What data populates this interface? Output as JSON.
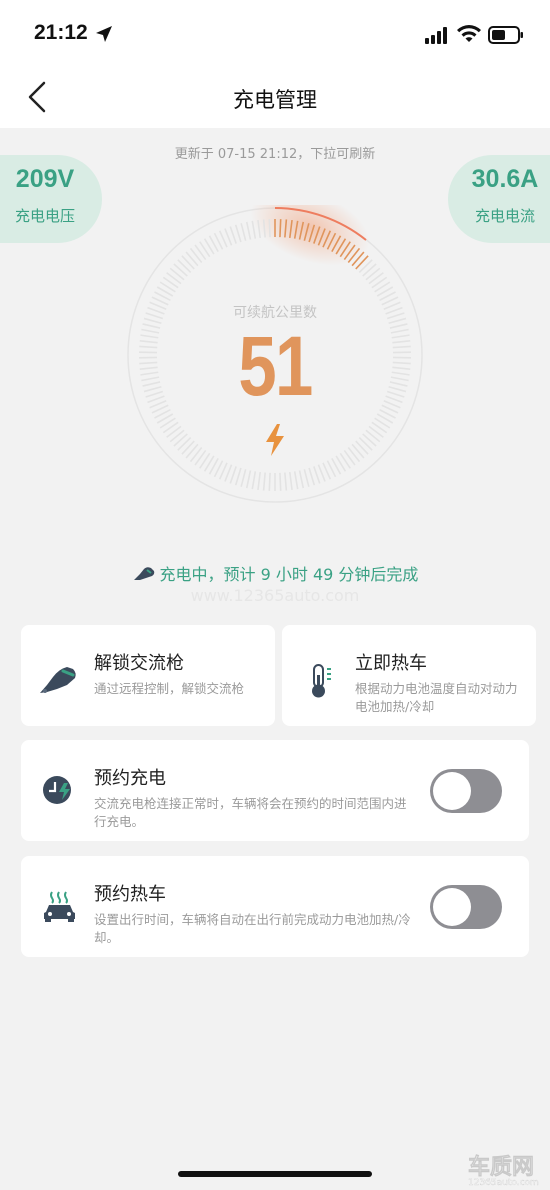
{
  "status_bar": {
    "time": "21:12",
    "icons": [
      "location-arrow-icon",
      "cellular-signal-icon",
      "wifi-icon",
      "battery-icon"
    ]
  },
  "header": {
    "title": "充电管理",
    "back_icon": "chevron-left-icon"
  },
  "update_text": "更新于 07-15 21:12，下拉可刷新",
  "voltage": {
    "value": "209V",
    "label": "充电电压"
  },
  "current": {
    "value": "30.6A",
    "label": "充电电流"
  },
  "gauge": {
    "label": "可续航公里数",
    "value": "51",
    "icon": "lightning-bolt-icon",
    "colors": {
      "accent": "#e0955c",
      "track": "#e3e3e3"
    }
  },
  "charge_status": "充电中，预计 9 小时 49 分钟后完成",
  "watermark": "www.12365auto.com",
  "cards": {
    "unlock": {
      "title": "解锁交流枪",
      "desc": "通过远程控制，解锁交流枪",
      "icon": "charging-gun-icon"
    },
    "heat_now": {
      "title": "立即热车",
      "desc": "根据动力电池温度自动对动力电池加热/冷却",
      "icon": "thermometer-icon"
    },
    "schedule_charge": {
      "title": "预约充电",
      "desc": "交流充电枪连接正常时，车辆将会在预约的时间范围内进行充电。",
      "icon": "clock-charge-icon",
      "toggle_on": false
    },
    "schedule_heat": {
      "title": "预约热车",
      "desc": "设置出行时间，车辆将自动在出行前完成动力电池加热/冷却。",
      "icon": "car-heating-icon",
      "toggle_on": false
    }
  },
  "colors": {
    "brand_green": "#3aa184",
    "accent_orange": "#e0955c",
    "toggle_off": "#8e8e93"
  },
  "logo": {
    "text": "车质网",
    "url_text": "12365auto.com"
  }
}
